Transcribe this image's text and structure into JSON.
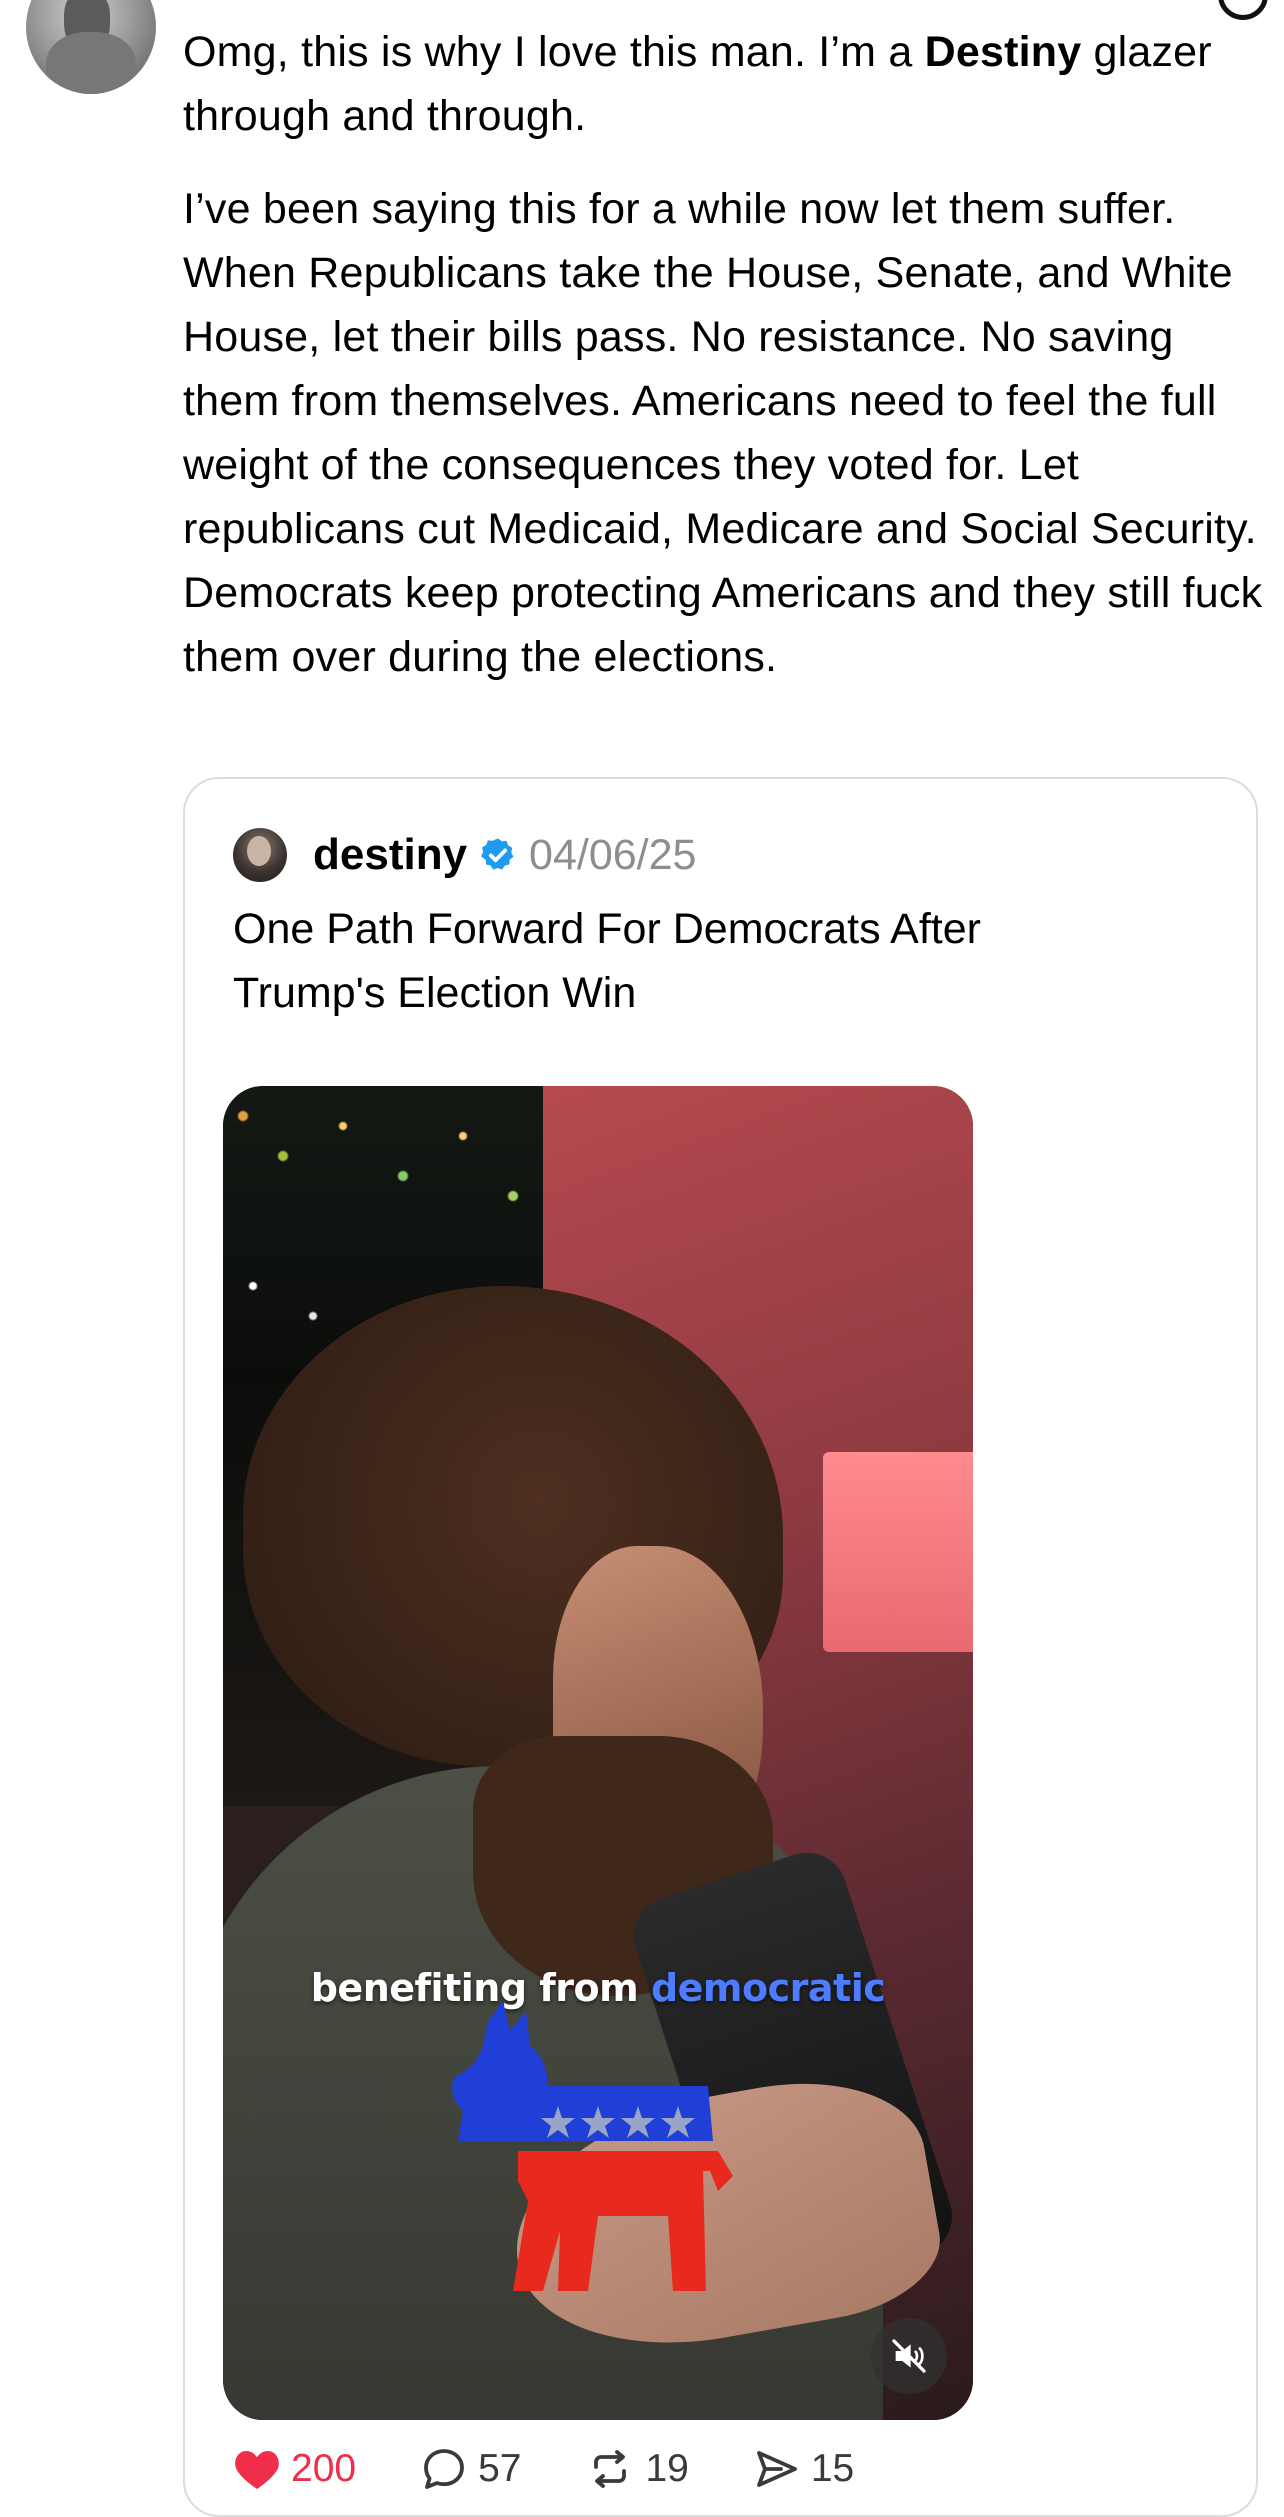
{
  "post": {
    "paragraph1_before": "Omg, this is why I love this man. I’m a ",
    "paragraph1_bold": "Destiny",
    "paragraph1_after": " glazer through and through.",
    "paragraph2": "I’ve been saying this for a while now let them suffer. When Republicans take the House, Senate, and White House, let their bills pass. No resistance. No saving them from themselves. Americans need to feel the full weight of the consequences they voted for. Let republicans cut Medicaid, Medicare and Social Security. Democrats keep protecting Americans and they still fuck them over during the elections."
  },
  "quote": {
    "author": "destiny",
    "verified": true,
    "date": "04/06/25",
    "title": "One Path Forward For Democrats After Trump's Election Win",
    "video": {
      "caption_plain": "benefiting from ",
      "caption_highlight": "democratic",
      "muted": true
    }
  },
  "actions": {
    "likes": "200",
    "replies": "57",
    "reposts": "19",
    "shares": "15"
  },
  "colors": {
    "like": "#ee2e4a",
    "verified": "#1d9bf0",
    "date": "#8e8e8e",
    "caption_highlight": "#4d7cff"
  },
  "icons": {
    "like": "heart-icon",
    "reply": "speech-bubble-icon",
    "repost": "repost-icon",
    "share": "paper-plane-icon",
    "verified": "verified-badge-icon",
    "mute": "speaker-muted-icon"
  }
}
